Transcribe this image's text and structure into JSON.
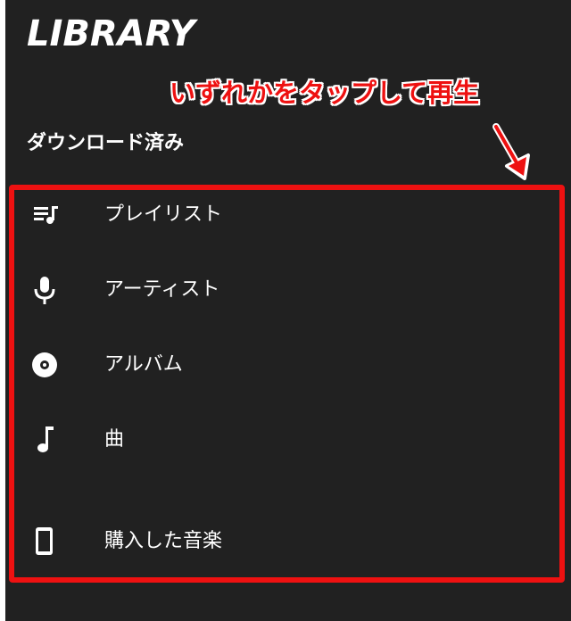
{
  "header": {
    "title": "LIBRARY"
  },
  "annotation": {
    "text": "いずれかをタップして再生",
    "color": "#ee1111"
  },
  "downloads": {
    "heading": "ダウンロード済み",
    "items": [
      {
        "label": "プレイリスト",
        "icon": "playlist-icon"
      },
      {
        "label": "アーティスト",
        "icon": "microphone-icon"
      },
      {
        "label": "アルバム",
        "icon": "album-disc-icon"
      },
      {
        "label": "曲",
        "icon": "music-note-icon"
      },
      {
        "label": "購入した音楽",
        "icon": "smartphone-icon"
      }
    ]
  },
  "colors": {
    "background": "#212121",
    "text": "#ffffff",
    "highlight": "#ee1111"
  }
}
